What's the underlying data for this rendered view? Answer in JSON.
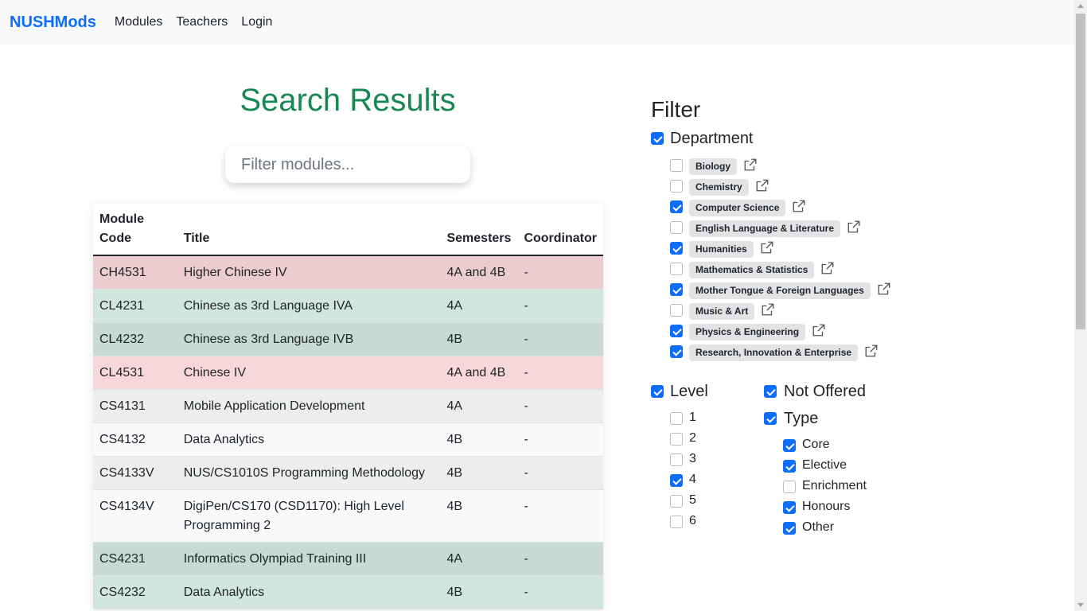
{
  "nav": {
    "brand": "NUSHMods",
    "links": [
      "Modules",
      "Teachers",
      "Login"
    ]
  },
  "results": {
    "title": "Search Results",
    "search_placeholder": "Filter modules...",
    "headers": [
      "Module Code",
      "Title",
      "Semesters",
      "Coordinator"
    ],
    "rows": [
      {
        "code": "CH4531",
        "title": "Higher Chinese IV",
        "semesters": "4A and 4B",
        "coordinator": "-",
        "tone": "danger"
      },
      {
        "code": "CL4231",
        "title": "Chinese as 3rd Language IVA",
        "semesters": "4A",
        "coordinator": "-",
        "tone": "success"
      },
      {
        "code": "CL4232",
        "title": "Chinese as 3rd Language IVB",
        "semesters": "4B",
        "coordinator": "-",
        "tone": "success"
      },
      {
        "code": "CL4531",
        "title": "Chinese IV",
        "semesters": "4A and 4B",
        "coordinator": "-",
        "tone": "danger"
      },
      {
        "code": "CS4131",
        "title": "Mobile Application Development",
        "semesters": "4A",
        "coordinator": "-",
        "tone": "light"
      },
      {
        "code": "CS4132",
        "title": "Data Analytics",
        "semesters": "4B",
        "coordinator": "-",
        "tone": "light"
      },
      {
        "code": "CS4133V",
        "title": "NUS/CS1010S Programming Methodology",
        "semesters": "4B",
        "coordinator": "-",
        "tone": "light"
      },
      {
        "code": "CS4134V",
        "title": "DigiPen/CS170 (CSD1170): High Level Programming 2",
        "semesters": "4B",
        "coordinator": "-",
        "tone": "light"
      },
      {
        "code": "CS4231",
        "title": "Informatics Olympiad Training III",
        "semesters": "4A",
        "coordinator": "-",
        "tone": "success"
      },
      {
        "code": "CS4232",
        "title": "Data Analytics",
        "semesters": "4B",
        "coordinator": "-",
        "tone": "success"
      }
    ]
  },
  "filter": {
    "title": "Filter",
    "department": {
      "label": "Department",
      "checked": true,
      "items": [
        {
          "label": "Biology",
          "checked": false
        },
        {
          "label": "Chemistry",
          "checked": false
        },
        {
          "label": "Computer Science",
          "checked": true
        },
        {
          "label": "English Language & Literature",
          "checked": false
        },
        {
          "label": "Humanities",
          "checked": true
        },
        {
          "label": "Mathematics & Statistics",
          "checked": false
        },
        {
          "label": "Mother Tongue & Foreign Languages",
          "checked": true
        },
        {
          "label": "Music & Art",
          "checked": false
        },
        {
          "label": "Physics & Engineering",
          "checked": true
        },
        {
          "label": "Research, Innovation & Enterprise",
          "checked": true
        }
      ]
    },
    "level": {
      "label": "Level",
      "checked": true,
      "items": [
        {
          "label": "1",
          "checked": false
        },
        {
          "label": "2",
          "checked": false
        },
        {
          "label": "3",
          "checked": false
        },
        {
          "label": "4",
          "checked": true
        },
        {
          "label": "5",
          "checked": false
        },
        {
          "label": "6",
          "checked": false
        }
      ]
    },
    "not_offered": {
      "label": "Not Offered",
      "checked": true
    },
    "type": {
      "label": "Type",
      "checked": true,
      "items": [
        {
          "label": "Core",
          "checked": true
        },
        {
          "label": "Elective",
          "checked": true
        },
        {
          "label": "Enrichment",
          "checked": false
        },
        {
          "label": "Honours",
          "checked": true
        },
        {
          "label": "Other",
          "checked": true
        }
      ]
    }
  }
}
